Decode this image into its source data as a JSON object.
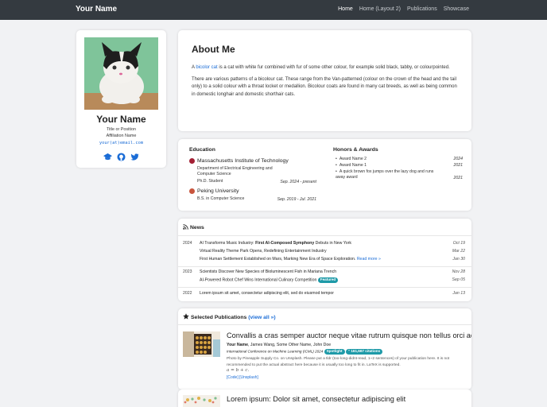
{
  "navbar": {
    "brand": "Your Name",
    "links": [
      "Home",
      "Home (Layout 2)",
      "Publications",
      "Showcase"
    ]
  },
  "profile": {
    "name": "Your Name",
    "title": "Title or Position",
    "affiliation": "Affiliation Name",
    "email": "your(at)email.com",
    "social_icons": [
      "graduation-cap-icon",
      "github-icon",
      "twitter-icon"
    ]
  },
  "about": {
    "heading": "About Me",
    "p1_prefix": "A ",
    "p1_link": "bicolor cat",
    "p1_rest": " is a cat with white fur combined with fur of some other colour, for example solid black, tabby, or colourpointed.",
    "p2": "There are various patterns of a bicolour cat. These range from the Van-patterned (colour on the crown of the head and the tail only) to a solid colour with a throat locket or medallion. Bicolour coats are found in many cat breeds, as well as being common in domestic longhair and domestic shorthair cats."
  },
  "education": {
    "heading": "Education",
    "schools": [
      {
        "name": "Massachusetts Institute of Technology",
        "dept": "Department of Electrical Engineering and Computer Science",
        "degree": "Ph.D. Student",
        "dates": "Sep. 2024 - present"
      },
      {
        "name": "Peking University",
        "dept": "B.S. in Computer Science",
        "degree": "",
        "dates": "Sep. 2019 - Jul. 2021"
      }
    ]
  },
  "honors": {
    "heading": "Honors & Awards",
    "items": [
      {
        "title": "Award Name 2",
        "year": "2024"
      },
      {
        "title": "Award Name 1",
        "year": "2021"
      },
      {
        "title": "A quick brown fox jumps over the lazy dog and runs away award",
        "year": "2021"
      }
    ]
  },
  "news": {
    "heading": "News",
    "read_more": "Read more",
    "featured": "Featured",
    "items": [
      {
        "year": "2024",
        "pre": "AI Transforms Music Industry: ",
        "bold": "First AI-Composed Symphony",
        "post": " Debuts in New York",
        "date": "Oct 19"
      },
      {
        "year": "",
        "pre": "Virtual Reality Theme Park Opens, Redefining Entertainment Industry",
        "bold": "",
        "post": "",
        "date": "Mar 22"
      },
      {
        "year": "",
        "pre": "First Human Settlement Established on Mars, Marking New Era of Space Exploration.",
        "bold": "",
        "post": "",
        "date": "Jan 30"
      },
      {
        "year": "2023",
        "pre": "Scientists Discover New Species of Bioluminescent Fish in Mariana Trench",
        "bold": "",
        "post": "",
        "date": "Nov 28"
      },
      {
        "year": "",
        "pre": "AI-Powered Robot Chef Wins International Culinary Competition",
        "bold": "",
        "post": "",
        "date": "Sep 05"
      },
      {
        "year": "2022",
        "pre": "Lorem ipsum sit amet, consectetur adipiscing elit, sed do eiusmod tempor",
        "bold": "",
        "post": "",
        "date": "Jan 13"
      }
    ]
  },
  "publications": {
    "heading": "Selected Publications",
    "view_all": "view all",
    "items": [
      {
        "title": "Convallis a cras semper auctor neque vitae rutrum quisque non tellus orci ac",
        "author_me": "Your Name",
        "authors_rest": ", James Wang, Some Other Name, John Doe",
        "venue": "International Conference on Machine Learning (ICML) 2024",
        "badge1": "Spotlight",
        "badge2": "161,667 citations",
        "desc": "Photo by Pineapple Supply Co. on Unsplash. Please put a tldr (too-long-didnt-read, 1~2 sentences) of your publication here. It is not recommended to put the actual abstract here because it is usually too long to fit in. LaTeX is supported.",
        "formula": "a = b + c.",
        "links": "[Code] [Unsplash]"
      },
      {
        "title": "Lorem ipsum: Dolor sit amet, consectetur adipiscing elit"
      }
    ]
  }
}
